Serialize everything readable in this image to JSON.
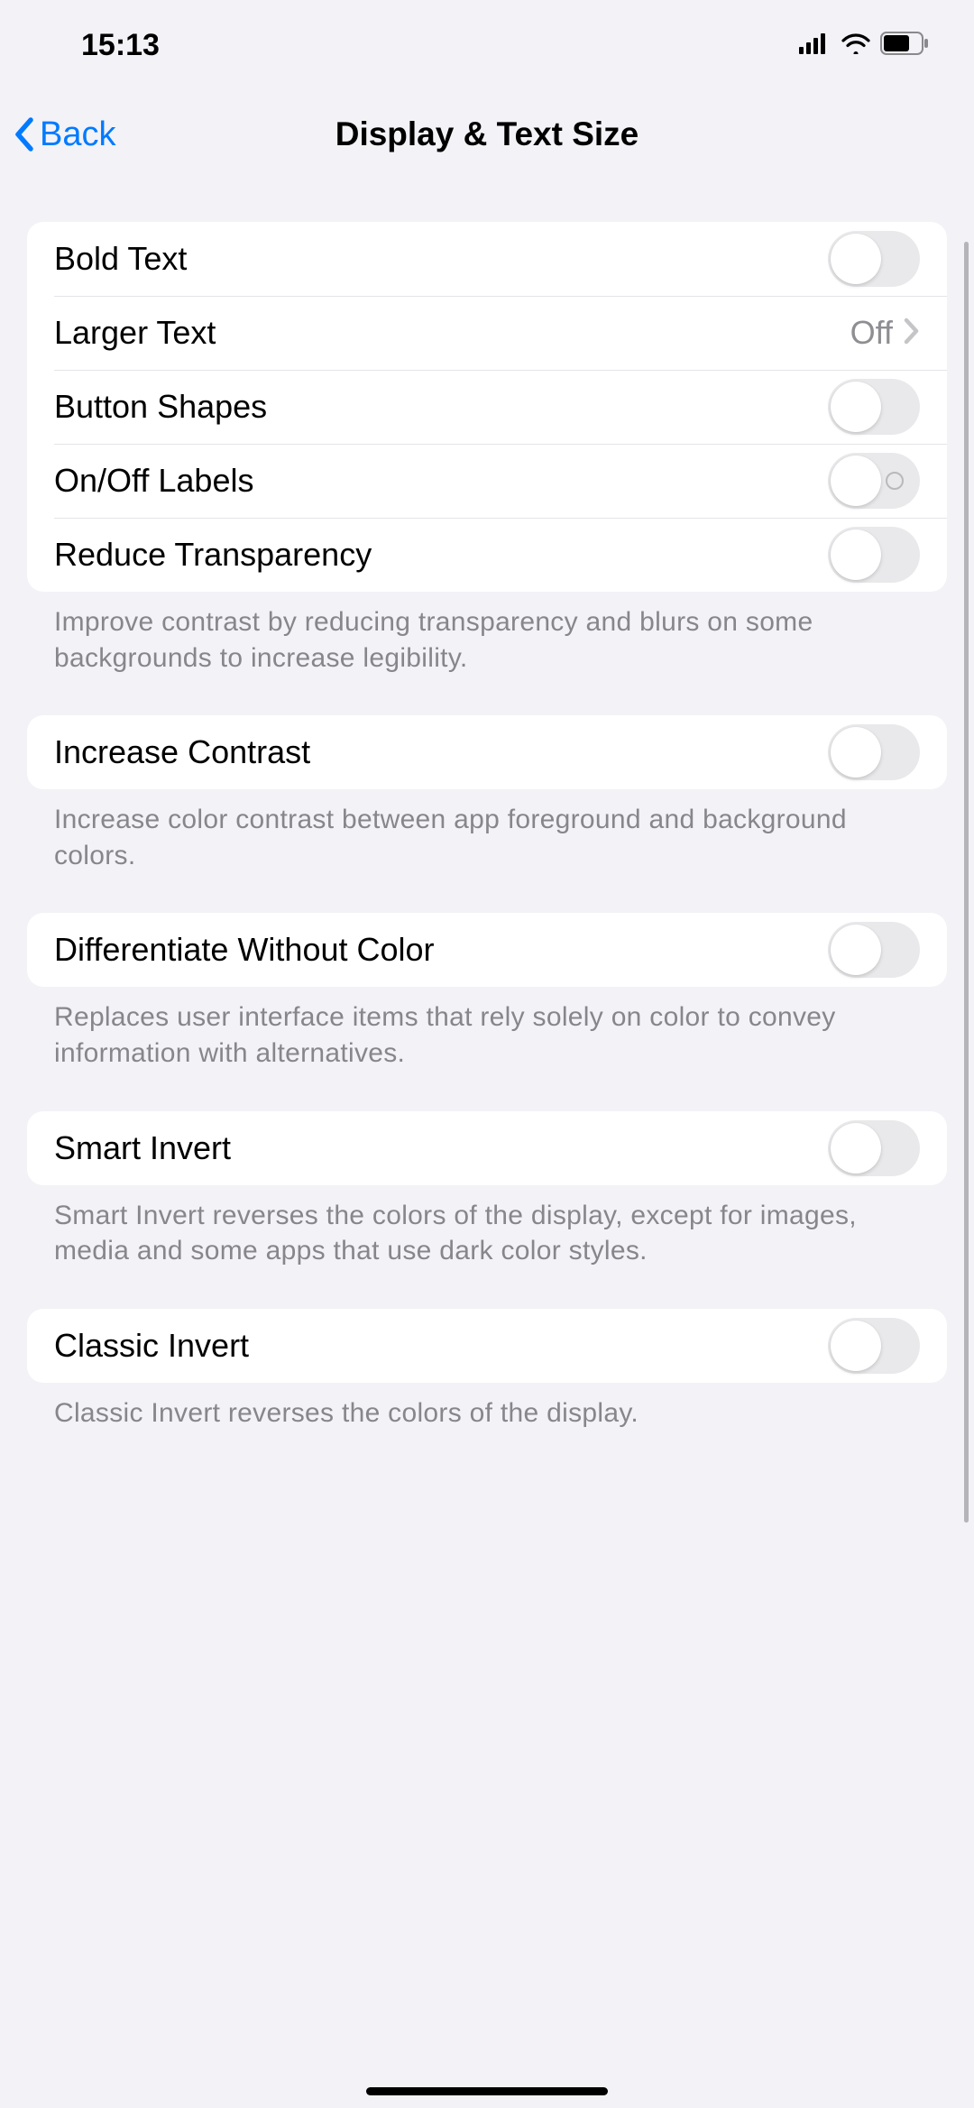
{
  "status": {
    "time": "15:13"
  },
  "nav": {
    "back": "Back",
    "title": "Display & Text Size"
  },
  "groups": [
    {
      "cells": [
        {
          "id": "bold-text",
          "label": "Bold Text",
          "type": "switch",
          "on": false,
          "withLabel": false
        },
        {
          "id": "larger-text",
          "label": "Larger Text",
          "type": "link",
          "value": "Off"
        },
        {
          "id": "button-shapes",
          "label": "Button Shapes",
          "type": "switch",
          "on": false,
          "withLabel": false
        },
        {
          "id": "onoff-labels",
          "label": "On/Off Labels",
          "type": "switch",
          "on": false,
          "withLabel": true
        },
        {
          "id": "reduce-transparency",
          "label": "Reduce Transparency",
          "type": "switch",
          "on": false,
          "withLabel": false
        }
      ],
      "footer": "Improve contrast by reducing transparency and blurs on some backgrounds to increase legibility."
    },
    {
      "cells": [
        {
          "id": "increase-contrast",
          "label": "Increase Contrast",
          "type": "switch",
          "on": false,
          "withLabel": false
        }
      ],
      "footer": "Increase color contrast between app foreground and background colors."
    },
    {
      "cells": [
        {
          "id": "differentiate-without-color",
          "label": "Differentiate Without Color",
          "type": "switch",
          "on": false,
          "withLabel": false
        }
      ],
      "footer": "Replaces user interface items that rely solely on color to convey information with alternatives."
    },
    {
      "cells": [
        {
          "id": "smart-invert",
          "label": "Smart Invert",
          "type": "switch",
          "on": false,
          "withLabel": false
        }
      ],
      "footer": "Smart Invert reverses the colors of the display, except for images, media and some apps that use dark color styles."
    },
    {
      "cells": [
        {
          "id": "classic-invert",
          "label": "Classic Invert",
          "type": "switch",
          "on": false,
          "withLabel": false
        }
      ],
      "footer": "Classic Invert reverses the colors of the display."
    }
  ]
}
